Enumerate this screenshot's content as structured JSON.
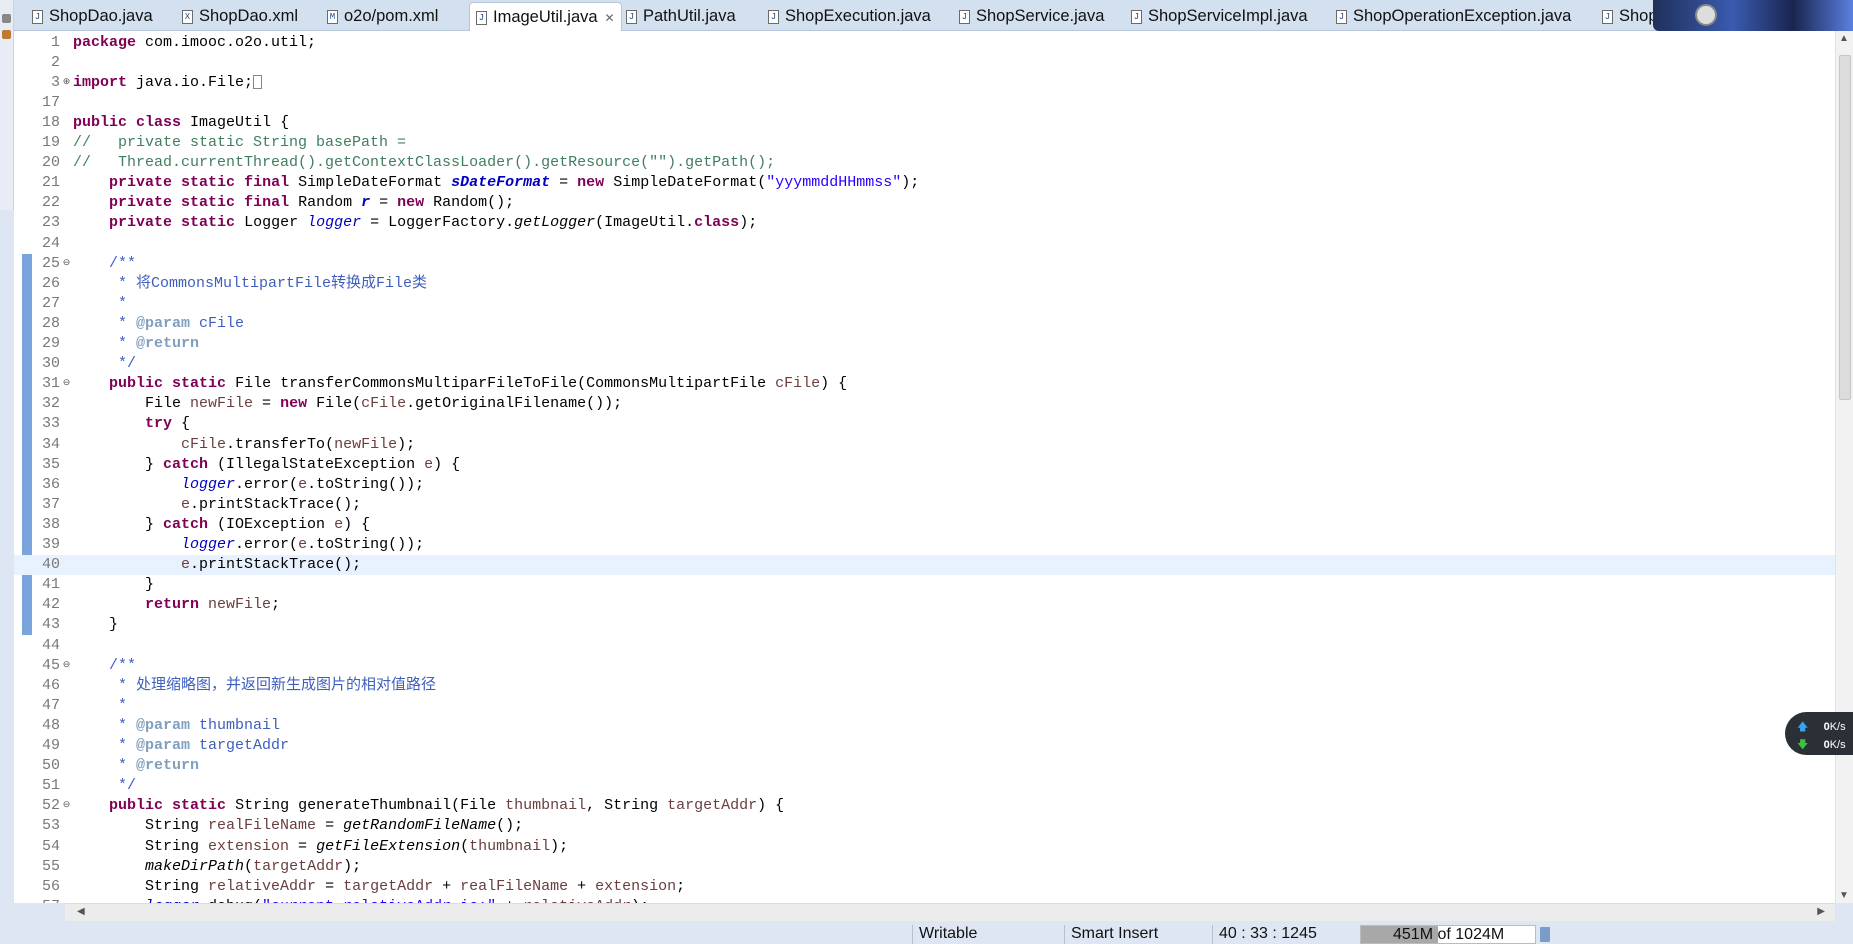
{
  "tabs": [
    {
      "label": "ShopDao.java",
      "icon": "J"
    },
    {
      "label": "ShopDao.xml",
      "icon": "X"
    },
    {
      "label": "o2o/pom.xml",
      "icon": "M"
    },
    {
      "label": "ImageUtil.java",
      "icon": "J",
      "active": true,
      "close": "✕"
    },
    {
      "label": "PathUtil.java",
      "icon": "J"
    },
    {
      "label": "ShopExecution.java",
      "icon": "J"
    },
    {
      "label": "ShopService.java",
      "icon": "J"
    },
    {
      "label": "ShopServiceImpl.java",
      "icon": "J"
    },
    {
      "label": "ShopOperationException.java",
      "icon": "J"
    },
    {
      "label": "ShopS",
      "icon": "J"
    }
  ],
  "editor": {
    "current_line": "40",
    "lines": [
      {
        "n": "1",
        "t": [
          [
            "k",
            "package"
          ],
          [
            "p",
            " com.imooc.o2o.util;"
          ]
        ]
      },
      {
        "n": "2",
        "t": []
      },
      {
        "n": "3",
        "fold": "+",
        "t": [
          [
            "k",
            "import"
          ],
          [
            "p",
            " java.io.File;"
          ]
        ],
        "collapsed": true
      },
      {
        "n": "17",
        "t": []
      },
      {
        "n": "18",
        "t": [
          [
            "k",
            "public"
          ],
          [
            "p",
            " "
          ],
          [
            "k",
            "class"
          ],
          [
            "p",
            " ImageUtil {"
          ]
        ]
      },
      {
        "n": "19",
        "t": [
          [
            "c",
            "//   private static String basePath ="
          ]
        ]
      },
      {
        "n": "20",
        "t": [
          [
            "c",
            "//   Thread.currentThread().getContextClassLoader().getResource(\"\").getPath();"
          ]
        ]
      },
      {
        "n": "21",
        "t": [
          [
            "p",
            "    "
          ],
          [
            "k",
            "private"
          ],
          [
            "p",
            " "
          ],
          [
            "k",
            "static"
          ],
          [
            "p",
            " "
          ],
          [
            "k",
            "final"
          ],
          [
            "p",
            " SimpleDateFormat "
          ],
          [
            "f",
            "sDateFormat"
          ],
          [
            "p",
            " = "
          ],
          [
            "k",
            "new"
          ],
          [
            "p",
            " SimpleDateFormat("
          ],
          [
            "s",
            "\"yyymmddHHmmss\""
          ],
          [
            "p",
            ");"
          ]
        ]
      },
      {
        "n": "22",
        "t": [
          [
            "p",
            "    "
          ],
          [
            "k",
            "private"
          ],
          [
            "p",
            " "
          ],
          [
            "k",
            "static"
          ],
          [
            "p",
            " "
          ],
          [
            "k",
            "final"
          ],
          [
            "p",
            " Random "
          ],
          [
            "f",
            "r"
          ],
          [
            "p",
            " = "
          ],
          [
            "k",
            "new"
          ],
          [
            "p",
            " Random();"
          ]
        ]
      },
      {
        "n": "23",
        "t": [
          [
            "p",
            "    "
          ],
          [
            "k",
            "private"
          ],
          [
            "p",
            " "
          ],
          [
            "k",
            "static"
          ],
          [
            "p",
            " Logger "
          ],
          [
            "l",
            "logger"
          ],
          [
            "p",
            " = LoggerFactory."
          ],
          [
            "i",
            "getLogger"
          ],
          [
            "p",
            "(ImageUtil."
          ],
          [
            "k",
            "class"
          ],
          [
            "p",
            ");"
          ]
        ]
      },
      {
        "n": "24",
        "t": []
      },
      {
        "n": "25",
        "fold": "-",
        "t": [
          [
            "j",
            "    /**"
          ]
        ]
      },
      {
        "n": "26",
        "t": [
          [
            "j",
            "     * 将CommonsMultipartFile转换成File类"
          ]
        ]
      },
      {
        "n": "27",
        "t": [
          [
            "j",
            "     *"
          ]
        ]
      },
      {
        "n": "28",
        "t": [
          [
            "j",
            "     * "
          ],
          [
            "t",
            "@param"
          ],
          [
            "j",
            " cFile"
          ]
        ]
      },
      {
        "n": "29",
        "t": [
          [
            "j",
            "     * "
          ],
          [
            "t",
            "@return"
          ]
        ]
      },
      {
        "n": "30",
        "t": [
          [
            "j",
            "     */"
          ]
        ]
      },
      {
        "n": "31",
        "fold": "-",
        "t": [
          [
            "p",
            "    "
          ],
          [
            "k",
            "public"
          ],
          [
            "p",
            " "
          ],
          [
            "k",
            "static"
          ],
          [
            "p",
            " File transferCommonsMultiparFileToFile(CommonsMultipartFile "
          ],
          [
            "v",
            "cFile"
          ],
          [
            "p",
            ") {"
          ]
        ]
      },
      {
        "n": "32",
        "t": [
          [
            "p",
            "        File "
          ],
          [
            "v",
            "newFile"
          ],
          [
            "p",
            " = "
          ],
          [
            "k",
            "new"
          ],
          [
            "p",
            " File("
          ],
          [
            "v",
            "cFile"
          ],
          [
            "p",
            ".getOriginalFilename());"
          ]
        ]
      },
      {
        "n": "33",
        "t": [
          [
            "p",
            "        "
          ],
          [
            "k",
            "try"
          ],
          [
            "p",
            " {"
          ]
        ]
      },
      {
        "n": "34",
        "t": [
          [
            "p",
            "            "
          ],
          [
            "v",
            "cFile"
          ],
          [
            "p",
            ".transferTo("
          ],
          [
            "v",
            "newFile"
          ],
          [
            "p",
            ");"
          ]
        ]
      },
      {
        "n": "35",
        "t": [
          [
            "p",
            "        } "
          ],
          [
            "k",
            "catch"
          ],
          [
            "p",
            " (IllegalStateException "
          ],
          [
            "v",
            "e"
          ],
          [
            "p",
            ") {"
          ]
        ]
      },
      {
        "n": "36",
        "t": [
          [
            "p",
            "            "
          ],
          [
            "l",
            "logger"
          ],
          [
            "p",
            ".error("
          ],
          [
            "v",
            "e"
          ],
          [
            "p",
            ".toString());"
          ]
        ]
      },
      {
        "n": "37",
        "t": [
          [
            "p",
            "            "
          ],
          [
            "v",
            "e"
          ],
          [
            "p",
            ".printStackTrace();"
          ]
        ]
      },
      {
        "n": "38",
        "t": [
          [
            "p",
            "        } "
          ],
          [
            "k",
            "catch"
          ],
          [
            "p",
            " (IOException "
          ],
          [
            "v",
            "e"
          ],
          [
            "p",
            ") {"
          ]
        ]
      },
      {
        "n": "39",
        "t": [
          [
            "p",
            "            "
          ],
          [
            "l",
            "logger"
          ],
          [
            "p",
            ".error("
          ],
          [
            "v",
            "e"
          ],
          [
            "p",
            ".toString());"
          ]
        ]
      },
      {
        "n": "40",
        "t": [
          [
            "p",
            "            "
          ],
          [
            "v",
            "e"
          ],
          [
            "p",
            ".printStackTrace();"
          ]
        ]
      },
      {
        "n": "41",
        "t": [
          [
            "p",
            "        }"
          ]
        ]
      },
      {
        "n": "42",
        "t": [
          [
            "p",
            "        "
          ],
          [
            "k",
            "return"
          ],
          [
            "p",
            " "
          ],
          [
            "v",
            "newFile"
          ],
          [
            "p",
            ";"
          ]
        ]
      },
      {
        "n": "43",
        "t": [
          [
            "p",
            "    }"
          ]
        ]
      },
      {
        "n": "44",
        "t": []
      },
      {
        "n": "45",
        "fold": "-",
        "t": [
          [
            "j",
            "    /**"
          ]
        ]
      },
      {
        "n": "46",
        "t": [
          [
            "j",
            "     * 处理缩略图，并返回新生成图片的相对值路径"
          ]
        ]
      },
      {
        "n": "47",
        "t": [
          [
            "j",
            "     *"
          ]
        ]
      },
      {
        "n": "48",
        "t": [
          [
            "j",
            "     * "
          ],
          [
            "t",
            "@param"
          ],
          [
            "j",
            " thumbnail"
          ]
        ]
      },
      {
        "n": "49",
        "t": [
          [
            "j",
            "     * "
          ],
          [
            "t",
            "@param"
          ],
          [
            "j",
            " targetAddr"
          ]
        ]
      },
      {
        "n": "50",
        "t": [
          [
            "j",
            "     * "
          ],
          [
            "t",
            "@return"
          ]
        ]
      },
      {
        "n": "51",
        "t": [
          [
            "j",
            "     */"
          ]
        ]
      },
      {
        "n": "52",
        "fold": "-",
        "t": [
          [
            "p",
            "    "
          ],
          [
            "k",
            "public"
          ],
          [
            "p",
            " "
          ],
          [
            "k",
            "static"
          ],
          [
            "p",
            " String generateThumbnail(File "
          ],
          [
            "v",
            "thumbnail"
          ],
          [
            "p",
            ", String "
          ],
          [
            "v",
            "targetAddr"
          ],
          [
            "p",
            ") {"
          ]
        ]
      },
      {
        "n": "53",
        "t": [
          [
            "p",
            "        String "
          ],
          [
            "v",
            "realFileName"
          ],
          [
            "p",
            " = "
          ],
          [
            "i",
            "getRandomFileName"
          ],
          [
            "p",
            "();"
          ]
        ]
      },
      {
        "n": "54",
        "t": [
          [
            "p",
            "        String "
          ],
          [
            "v",
            "extension"
          ],
          [
            "p",
            " = "
          ],
          [
            "i",
            "getFileExtension"
          ],
          [
            "p",
            "("
          ],
          [
            "v",
            "thumbnail"
          ],
          [
            "p",
            ");"
          ]
        ]
      },
      {
        "n": "55",
        "t": [
          [
            "p",
            "        "
          ],
          [
            "i",
            "makeDirPath"
          ],
          [
            "p",
            "("
          ],
          [
            "v",
            "targetAddr"
          ],
          [
            "p",
            ");"
          ]
        ]
      },
      {
        "n": "56",
        "t": [
          [
            "p",
            "        String "
          ],
          [
            "v",
            "relativeAddr"
          ],
          [
            "p",
            " = "
          ],
          [
            "v",
            "targetAddr"
          ],
          [
            "p",
            " + "
          ],
          [
            "v",
            "realFileName"
          ],
          [
            "p",
            " + "
          ],
          [
            "v",
            "extension"
          ],
          [
            "p",
            ";"
          ]
        ]
      },
      {
        "n": "57",
        "t": [
          [
            "p",
            "        "
          ],
          [
            "l",
            "logger"
          ],
          [
            "p",
            ".debug("
          ],
          [
            "s",
            "\"current relativeAddr is:\""
          ],
          [
            "p",
            " + "
          ],
          [
            "v",
            "relativeAddr"
          ],
          [
            "p",
            ");"
          ]
        ]
      }
    ]
  },
  "status": {
    "writable": "Writable",
    "insert_mode": "Smart Insert",
    "position": "40 : 33 : 1245",
    "memory_used": "451M",
    "memory_total": "of 1024M",
    "memory_fraction": 0.44
  },
  "network": {
    "up": "0",
    "down": "0",
    "unit": "K/s",
    "up_color": "#3aa0f0",
    "down_color": "#3cc040"
  }
}
